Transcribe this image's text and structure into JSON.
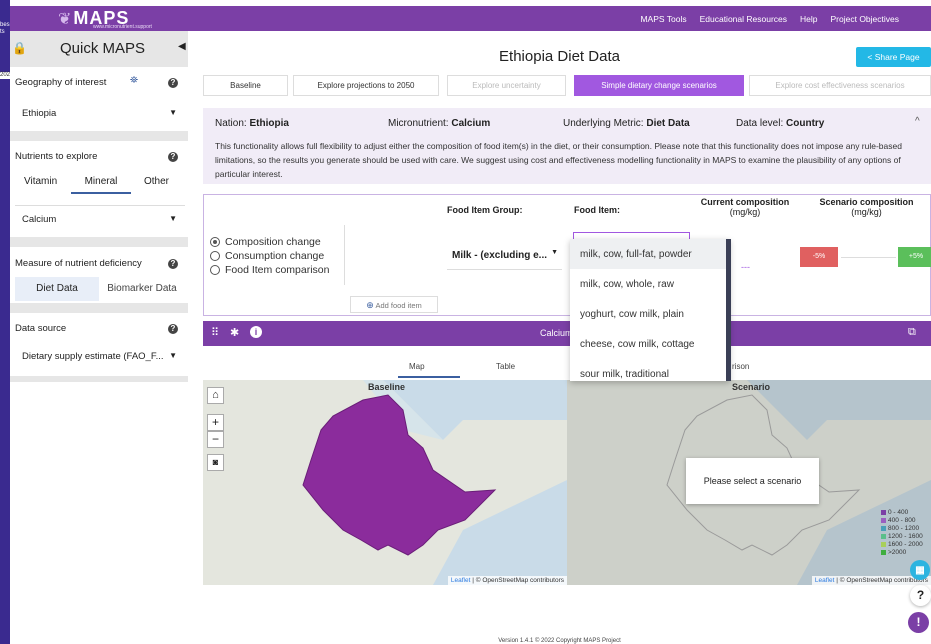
{
  "browser_strip": {
    "text1": "bes",
    "text2": "ts",
    "text3": "202"
  },
  "nav": {
    "logo": "MAPS",
    "logo_sub": "www.micronutrient.support",
    "links": [
      "MAPS Tools",
      "Educational Resources",
      "Help",
      "Project Objectives"
    ]
  },
  "sidebar": {
    "title": "Quick MAPS",
    "geography": {
      "heading": "Geography of interest",
      "value": "Ethiopia"
    },
    "nutrients": {
      "heading": "Nutrients to explore",
      "tabs": [
        "Vitamin",
        "Mineral",
        "Other"
      ],
      "active_tab": "Mineral",
      "value": "Calcium"
    },
    "deficiency": {
      "heading": "Measure of nutrient deficiency",
      "tabs": [
        "Diet Data",
        "Biomarker Data"
      ],
      "active_tab": "Diet Data"
    },
    "source": {
      "heading": "Data source",
      "value": "Dietary supply estimate (FAO_F..."
    }
  },
  "page": {
    "title": "Ethiopia Diet Data",
    "share_label": "Share Page",
    "tabs": [
      "Baseline",
      "Explore projections to 2050",
      "Explore uncertainty",
      "Simple dietary change scenarios",
      "Explore cost effectiveness scenarios"
    ],
    "active_tab": "Simple dietary change scenarios"
  },
  "info": {
    "nation_label": "Nation:",
    "nation": "Ethiopia",
    "micronutrient_label": "Micronutrient:",
    "micronutrient": "Calcium",
    "metric_label": "Underlying Metric:",
    "metric": "Diet Data",
    "level_label": "Data level:",
    "level": "Country",
    "description": "This functionality allows full flexibility to adjust either the composition of food item(s) in the diet, or their consumption. Please note that this functionality does not impose any rule-based limitations, so the results you generate should be used with care. We suggest using cost and effectiveness modelling functionality in MAPS to examine the plausibility of any options of particular interest."
  },
  "scenario": {
    "headers": {
      "group": "Food Item Group:",
      "item": "Food Item:",
      "current": "Current composition",
      "current_unit": "(mg/kg)",
      "scen": "Scenario composition",
      "scen_unit": "(mg/kg)"
    },
    "options": [
      "Composition change",
      "Consumption change",
      "Food Item comparison"
    ],
    "selected_option": "Composition change",
    "group_value": "Milk - (excluding e...",
    "current_value": "---",
    "minus_label": "-5%",
    "plus_label": "+5%",
    "add_label": "Add food item",
    "dropdown_items": [
      "milk, cow, full-fat, powder",
      "milk, cow, whole, raw",
      "yoghurt, cow milk, plain",
      "cheese, cow milk, cottage",
      "sour milk, traditional"
    ]
  },
  "panel": {
    "title": "Calcium",
    "subtabs": [
      "Map",
      "Table"
    ],
    "comparison_fragment": "rison",
    "map1_label": "Baseline",
    "map2_label": "Scenario",
    "popup": "Please select a scenario",
    "attribution_leaflet": "Leaflet",
    "attribution_rest": "| © OpenStreetMap contributors",
    "legend": [
      {
        "label": "0 - 400",
        "color": "#7b3fa6"
      },
      {
        "label": "400 - 800",
        "color": "#9b5fc0"
      },
      {
        "label": "800 - 1200",
        "color": "#4aa0b8"
      },
      {
        "label": "1200 - 1600",
        "color": "#5bbf8a"
      },
      {
        "label": "1600 - 2000",
        "color": "#a8cf5a"
      },
      {
        "label": ">2000",
        "color": "#3fae3f"
      }
    ]
  },
  "footer": "Version 1.4.1 © 2022 Copyright MAPS Project"
}
